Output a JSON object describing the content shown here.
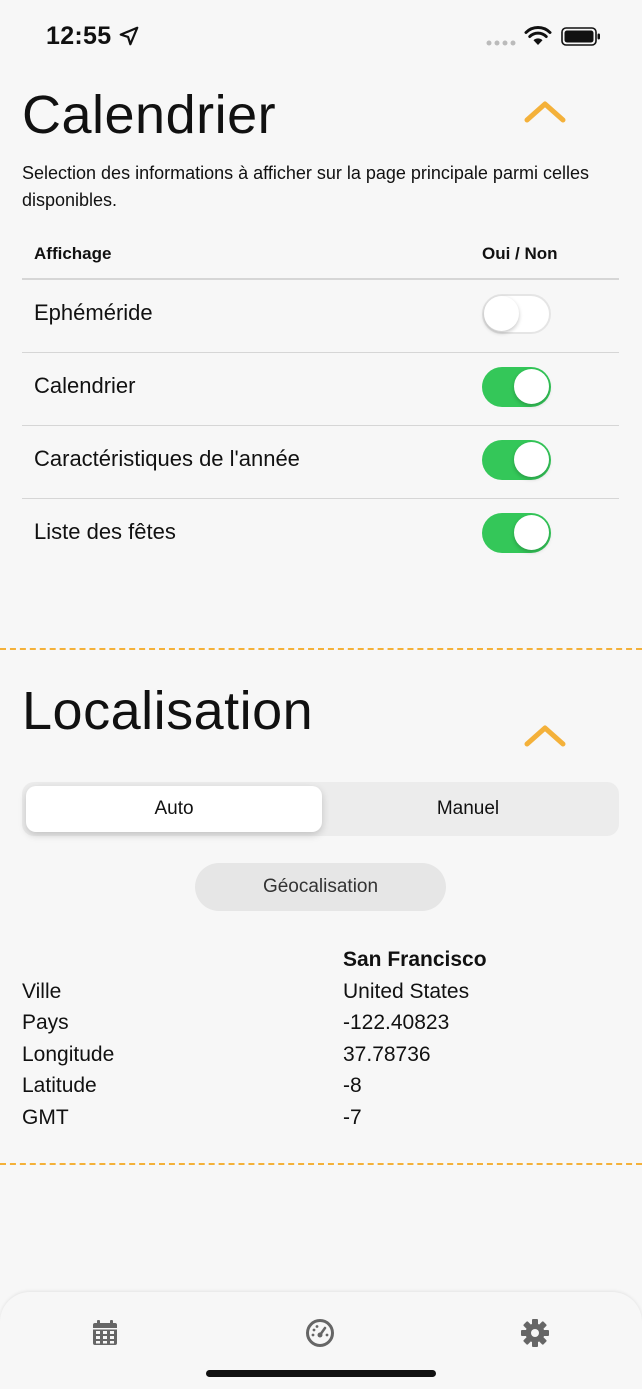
{
  "status_bar": {
    "time": "12:55"
  },
  "calendrier": {
    "title": "Calendrier",
    "description": "Selection des informations à afficher sur la page principale parmi celles disponibles.",
    "header": {
      "col1": "Affichage",
      "col2": "Oui / Non"
    },
    "rows": [
      {
        "label": "Ephéméride",
        "enabled": false
      },
      {
        "label": "Calendrier",
        "enabled": true
      },
      {
        "label": "Caractéristiques de l'année",
        "enabled": true
      },
      {
        "label": "Liste des fêtes",
        "enabled": true
      }
    ]
  },
  "localisation": {
    "title": "Localisation",
    "segments": {
      "selected": "Auto",
      "other": "Manuel"
    },
    "geo_button": "Géocalisation",
    "city": "San Francisco",
    "labels": [
      "Ville",
      "Pays",
      "Longitude",
      "Latitude",
      "GMT"
    ],
    "values": [
      "United States",
      "-122.40823",
      "37.78736",
      "-8",
      "-7"
    ]
  },
  "colors": {
    "accent": "#f4b13a",
    "toggle_on": "#34c759",
    "background": "#f7f7f7"
  },
  "tab_bar": {
    "icons": [
      "calendar-icon",
      "dashboard-icon",
      "gear-icon"
    ]
  }
}
